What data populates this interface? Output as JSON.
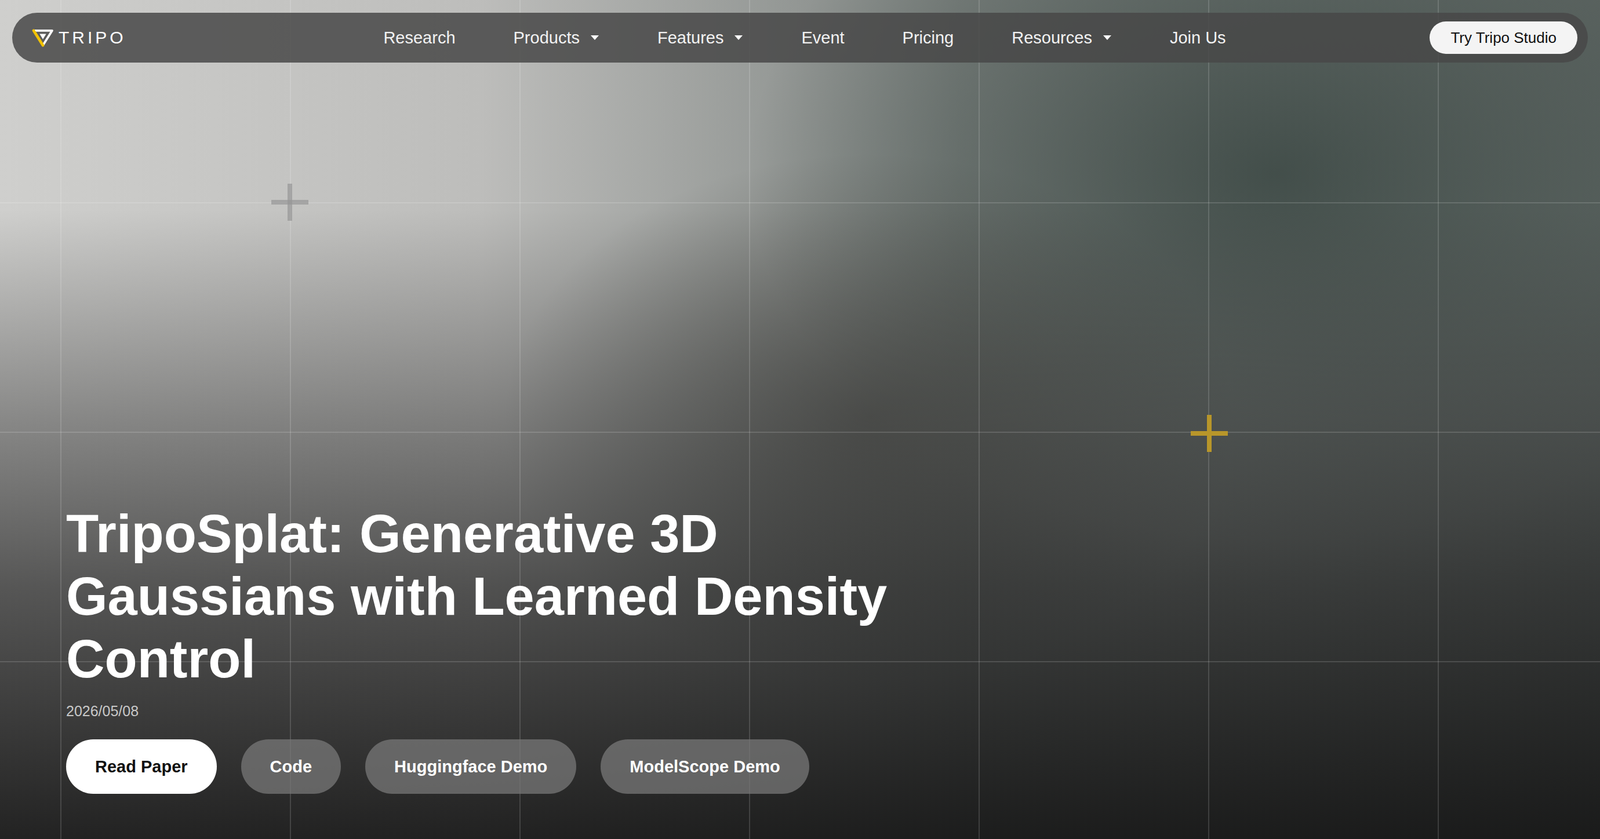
{
  "logo": {
    "text": "TRIPO"
  },
  "nav": {
    "items": [
      {
        "label": "Research",
        "dropdown": false
      },
      {
        "label": "Products",
        "dropdown": true
      },
      {
        "label": "Features",
        "dropdown": true
      },
      {
        "label": "Event",
        "dropdown": false
      },
      {
        "label": "Pricing",
        "dropdown": false
      },
      {
        "label": "Resources",
        "dropdown": true
      },
      {
        "label": "Join Us",
        "dropdown": false
      }
    ]
  },
  "cta": {
    "label": "Try Tripo Studio"
  },
  "hero": {
    "title": "TripoSplat: Generative 3D Gaussians with Learned Density Control",
    "date": "2026/05/08",
    "buttons": [
      {
        "label": "Read Paper",
        "primary": true
      },
      {
        "label": "Code",
        "primary": false
      },
      {
        "label": "Huggingface Demo",
        "primary": false
      },
      {
        "label": "ModelScope Demo",
        "primary": false
      }
    ]
  }
}
